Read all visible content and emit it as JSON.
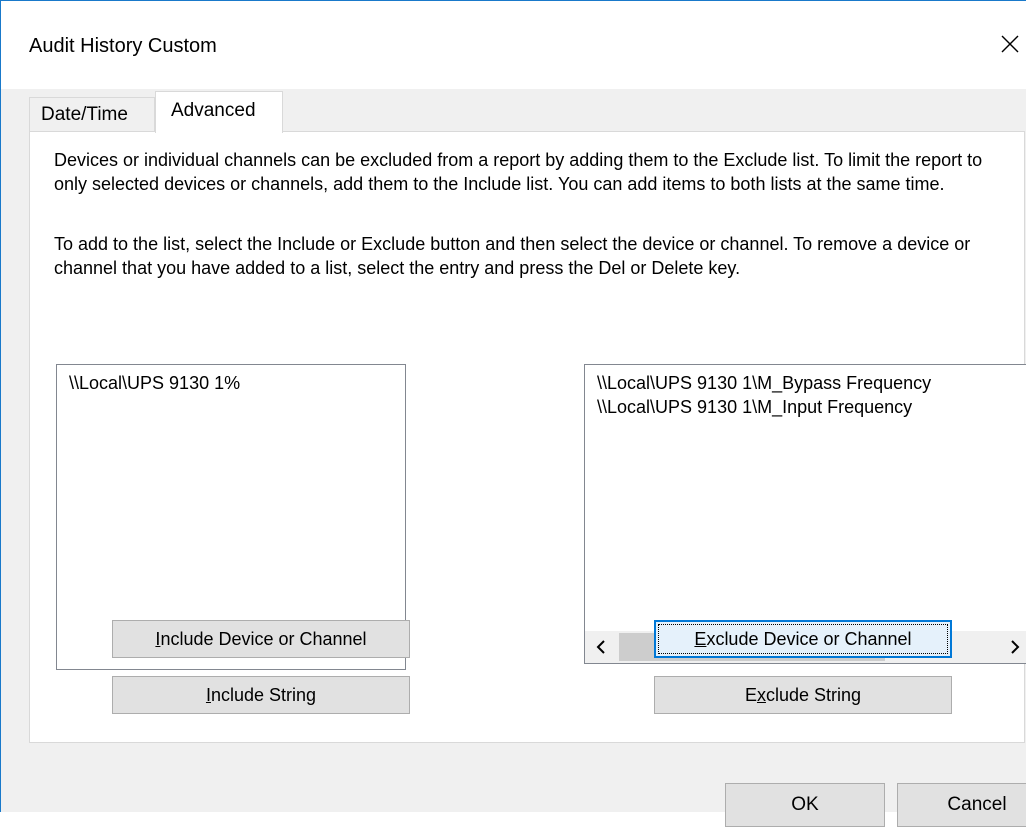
{
  "window": {
    "title": "Audit History Custom",
    "close_icon": "close-icon"
  },
  "tabs": [
    {
      "label": "Date/Time",
      "selected": false
    },
    {
      "label": "Advanced",
      "selected": true
    }
  ],
  "description": {
    "paragraph_1": "Devices or individual channels can be excluded from a report by adding them to the Exclude list. To limit the report to only selected devices or channels, add them to the Include list. You can add items to both lists at the same time.",
    "paragraph_2": "To add to the list, select the Include or Exclude button and then select the device or channel. To remove a device or channel that you have added to a list, select the entry and press the Del or Delete key."
  },
  "include_list": {
    "items": [
      "\\\\Local\\UPS 9130 1%"
    ]
  },
  "exclude_list": {
    "items": [
      "\\\\Local\\UPS 9130 1\\M_Bypass Frequency",
      "\\\\Local\\UPS 9130 1\\M_Input Frequency"
    ],
    "scroll_left_icon": "chevron-left-icon",
    "scroll_right_icon": "chevron-right-icon"
  },
  "buttons": {
    "include_device": {
      "mnemonic": "I",
      "rest": "nclude Device or Channel"
    },
    "include_string": {
      "mnemonic": "I",
      "rest": "nclude String"
    },
    "exclude_device": {
      "mnemonic": "E",
      "rest": "xclude Device or Channel"
    },
    "exclude_string": {
      "pre": "E",
      "mnemonic": "x",
      "rest": "clude String"
    },
    "ok": "OK",
    "cancel": "Cancel"
  },
  "colors": {
    "accent_border": "#1979ca",
    "focus_border": "#0078d7",
    "dialog_bg": "#f0f0f0",
    "panel_bg": "#ffffff",
    "button_bg": "#e1e1e1"
  }
}
